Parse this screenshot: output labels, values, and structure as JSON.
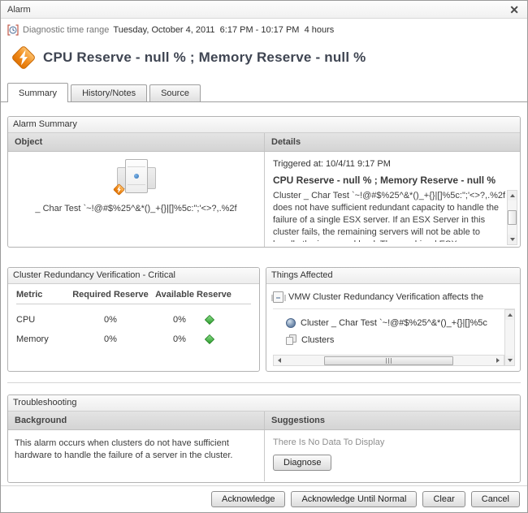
{
  "window": {
    "title": "Alarm"
  },
  "time_range": {
    "label": "Diagnostic time range",
    "value": "Tuesday, October 4, 2011  6:17 PM - 10:17 PM  4 hours"
  },
  "heading": "CPU Reserve - null % ; Memory Reserve - null %",
  "tabs": [
    {
      "label": "Summary",
      "active": true
    },
    {
      "label": "History/Notes",
      "active": false
    },
    {
      "label": "Source",
      "active": false
    }
  ],
  "alarm_summary": {
    "title": "Alarm Summary",
    "object_header": "Object",
    "details_header": "Details",
    "object_name": "_ Char Test `~!@#$%25^&*()_+{}|[]%5c:\";'<>?,.%2f",
    "triggered": "Triggered at: 10/4/11 9:17 PM",
    "details_title": "CPU Reserve - null % ; Memory Reserve - null %",
    "details_body": "Cluster _ Char Test `~!@#$%25^&*()_+{}|[]%5c:\";'<>?,.%2f does not have sufficient redundant capacity to handle the failure of a single ESX server. If an ESX Server in this cluster fails, the remaining servers will not be able to handle the increased load. The combined ESX"
  },
  "cluster_redundancy": {
    "title": "Cluster Redundancy Verification - Critical",
    "columns": [
      "Metric",
      "Required Reserve",
      "Available Reserve"
    ],
    "rows": [
      {
        "metric": "CPU",
        "required": "0%",
        "available": "0%",
        "status": "normal"
      },
      {
        "metric": "Memory",
        "required": "0%",
        "available": "0%",
        "status": "normal"
      }
    ]
  },
  "things_affected": {
    "title": "Things Affected",
    "rule_text": "VMW Cluster Redundancy Verification affects the",
    "items": [
      {
        "label": "Cluster _ Char Test `~!@#$%25^&*()_+{}|[]%5c",
        "icon": "globe-icon"
      },
      {
        "label": "Clusters",
        "icon": "clusters-icon"
      }
    ]
  },
  "troubleshooting": {
    "title": "Troubleshooting",
    "background_header": "Background",
    "suggestions_header": "Suggestions",
    "background_text": "This alarm occurs when clusters do not have sufficient hardware to handle the failure of a server in the cluster.",
    "no_data_text": "There Is No Data To Display",
    "diagnose_label": "Diagnose"
  },
  "footer": {
    "buttons": [
      "Acknowledge",
      "Acknowledge Until Normal",
      "Clear",
      "Cancel"
    ]
  },
  "colors": {
    "alarm_orange": "#ee7e10",
    "status_green": "#35a435",
    "header_gray": "#d9d9d9",
    "heading_text": "#3f4552"
  }
}
